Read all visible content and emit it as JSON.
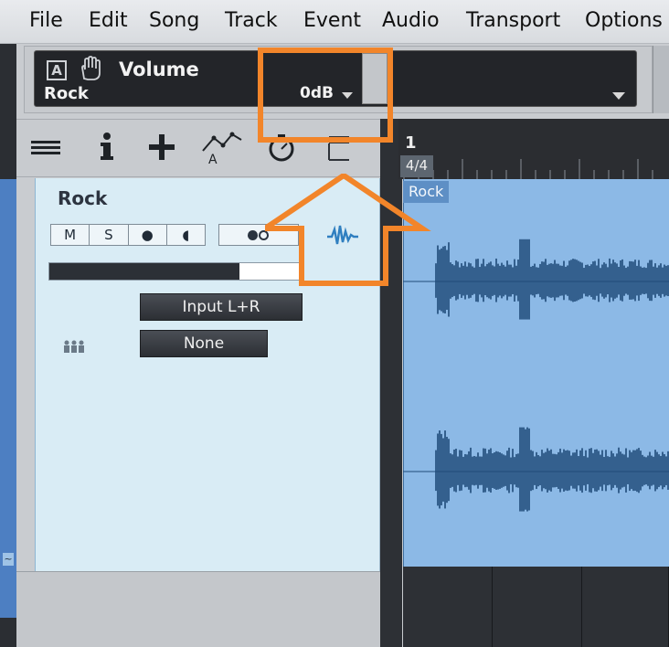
{
  "menu": [
    "File",
    "Edit",
    "Song",
    "Track",
    "Event",
    "Audio",
    "Transport",
    "Options"
  ],
  "inspector": {
    "parameter": "Volume",
    "track": "Rock",
    "value": "0dB",
    "a_label": "A"
  },
  "toolbar": {
    "icons": [
      "list-icon",
      "info-icon",
      "add-icon",
      "automation-icon",
      "clock-icon",
      "folder-icon"
    ]
  },
  "track": {
    "name": "Rock",
    "mute_label": "M",
    "solo_label": "S",
    "record_label": "●",
    "monitor_label": "◖",
    "meter_level": 0.76,
    "input": "Input L+R",
    "output": "None"
  },
  "arrange": {
    "bar_number": "1",
    "time_signature": "4/4",
    "clip_name": "Rock"
  },
  "colors": {
    "highlight": "#f2852a",
    "clip": "#8cb9e6",
    "waveform": "#1f4a78"
  }
}
